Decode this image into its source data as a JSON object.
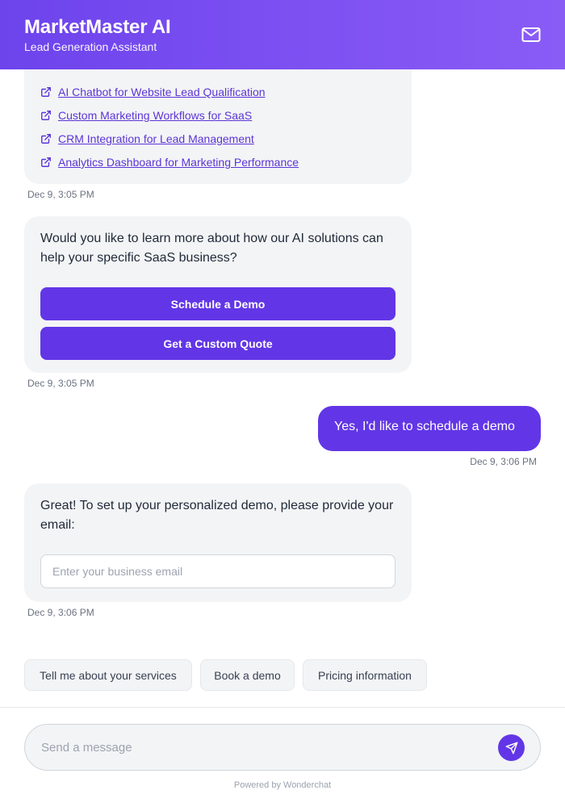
{
  "header": {
    "title": "MarketMaster AI",
    "subtitle": "Lead Generation Assistant",
    "icon": "mail-icon",
    "gradient": [
      "#6d43ec",
      "#8a5cf6"
    ]
  },
  "messages": [
    {
      "links": [
        "AI Chatbot for Website Lead Qualification",
        "Custom Marketing Workflows for SaaS",
        "CRM Integration for Lead Management",
        "Analytics Dashboard for Marketing Performance"
      ],
      "timestamp": "Dec 9, 3:05 PM"
    },
    {
      "text": "Would you like to learn more about how our AI solutions can help your specific SaaS business?",
      "buttons": [
        "Schedule a Demo",
        "Get a Custom Quote"
      ],
      "timestamp": "Dec 9, 3:05 PM"
    },
    {
      "text": "Yes, I'd like to schedule a demo",
      "timestamp": "Dec 9, 3:06 PM"
    },
    {
      "text": "Great! To set up your personalized demo, please provide your email:",
      "input_placeholder": "Enter your business email",
      "timestamp": "Dec 9, 3:06 PM"
    }
  ],
  "suggestions": [
    "Tell me about your services",
    "Book a demo",
    "Pricing information"
  ],
  "composer": {
    "placeholder": "Send a message",
    "send_icon": "send-icon"
  },
  "footer": "Powered by Wonderchat",
  "colors": {
    "accent": "#6236e6",
    "bubble_bot": "#f3f4f6",
    "link": "#5b35d5"
  }
}
